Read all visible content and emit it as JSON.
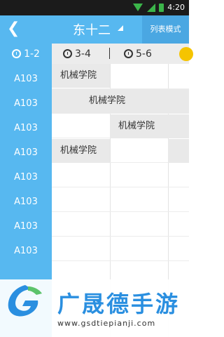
{
  "status_bar": {
    "time": "4:20"
  },
  "header": {
    "title": "东十二",
    "list_mode_label": "列表模式"
  },
  "tabs": [
    "1-2",
    "3-4",
    "5-6"
  ],
  "rooms": [
    "A103",
    "A103",
    "A103",
    "A103",
    "A103",
    "A103",
    "A103",
    "A103"
  ],
  "schedule": [
    {
      "text": "机械学院"
    },
    {
      "text": "机械学院"
    },
    {
      "text": "机械学院"
    },
    {
      "text": "机械学院"
    }
  ],
  "banner": {
    "brand": "广晟德手游",
    "url": "www.gsdtiepianji.com"
  },
  "colors": {
    "primary": "#57b8f0",
    "list_button": "#4aa7e2",
    "cell_bg": "#e9e9e9",
    "status_icons": "#3bb54a"
  }
}
